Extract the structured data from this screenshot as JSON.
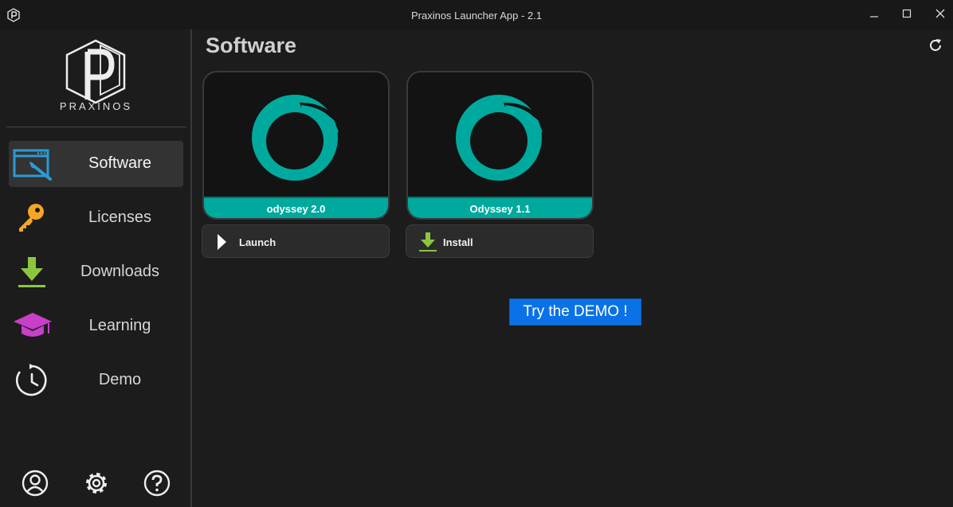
{
  "window": {
    "title": "Praxinos Launcher App - 2.1",
    "controls": [
      "minimize",
      "maximize",
      "close"
    ]
  },
  "sidebar": {
    "logo_text": "PRAXINOS",
    "items": [
      {
        "label": "Software",
        "icon": "software-icon",
        "active": true
      },
      {
        "label": "Licenses",
        "icon": "key-icon",
        "active": false
      },
      {
        "label": "Downloads",
        "icon": "download-icon",
        "active": false
      },
      {
        "label": "Learning",
        "icon": "graduation-cap-icon",
        "active": false
      },
      {
        "label": "Demo",
        "icon": "timer-icon",
        "active": false
      }
    ],
    "bottom_icons": [
      "user-icon",
      "gear-icon",
      "help-icon"
    ]
  },
  "main": {
    "title": "Software",
    "cards": [
      {
        "name": "odyssey 2.0",
        "action": "Launch",
        "action_icon": "play-icon"
      },
      {
        "name": "Odyssey 1.1",
        "action": "Install",
        "action_icon": "download-icon"
      }
    ],
    "demo_button": "Try the DEMO !"
  },
  "colors": {
    "accent_teal": "#00a99d",
    "demo_blue": "#0a72e6",
    "key_orange": "#f5a623",
    "download_green": "#8cc63f",
    "learning_magenta": "#c83fc8",
    "software_blue": "#2a9bd6"
  }
}
